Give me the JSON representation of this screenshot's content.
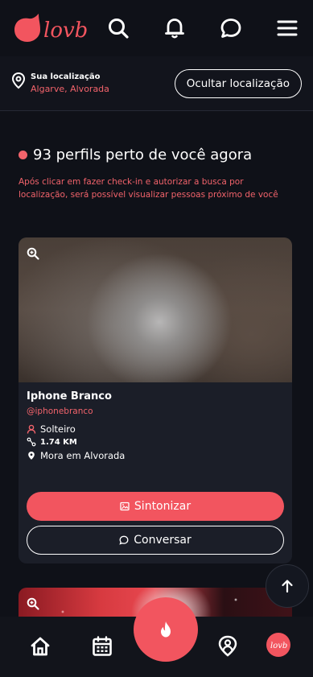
{
  "app": {
    "logo_text": "lovb",
    "accent_color": "#f2555f"
  },
  "header": {
    "icons": [
      "search-icon",
      "bell-icon",
      "chat-icon",
      "menu-icon"
    ]
  },
  "location": {
    "title": "Sua localização",
    "value": "Algarve, Alvorada",
    "hide_button": "Ocultar localização"
  },
  "main": {
    "headline": "93 perfils perto de você agora",
    "note": "Após clicar em fazer check-in e autorizar a busca por localização, será possível visualizar pessoas próximo de você"
  },
  "profiles": [
    {
      "name": "Iphone Branco",
      "handle": "@iphonebranco",
      "status": "Solteiro",
      "distance": "1.74 KM",
      "lives_in": "Mora em Alvorada",
      "tune_button": "Sintonizar",
      "chat_button": "Conversar"
    }
  ],
  "bottom_nav": {
    "items": [
      "home-icon",
      "calendar-icon",
      "flame-icon",
      "map-pin-icon",
      "profile-avatar"
    ]
  }
}
